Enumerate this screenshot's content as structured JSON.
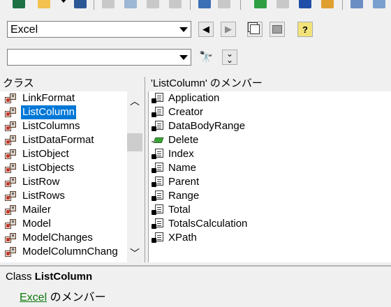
{
  "toolbar": {
    "icons": [
      "excel-icon",
      "userform-icon",
      "dropdown-icon",
      "save-icon",
      "cut-icon",
      "copy-icon",
      "paste-icon",
      "find-icon",
      "undo-icon",
      "redo-icon",
      "run-icon",
      "break-icon",
      "reset-icon",
      "design-mode-icon",
      "project-explorer-icon",
      "properties-icon"
    ]
  },
  "library": {
    "selected": "Excel",
    "buttons": [
      "previous",
      "next",
      "copy-to-clipboard",
      "view-definition",
      "help"
    ]
  },
  "search": {
    "value": "",
    "buttons": [
      "search",
      "show-hide-results"
    ]
  },
  "classes_pane": {
    "header": "クラス",
    "items": [
      {
        "label": "LinkFormat",
        "selected": false
      },
      {
        "label": "ListColumn",
        "selected": true
      },
      {
        "label": "ListColumns",
        "selected": false
      },
      {
        "label": "ListDataFormat",
        "selected": false
      },
      {
        "label": "ListObject",
        "selected": false
      },
      {
        "label": "ListObjects",
        "selected": false
      },
      {
        "label": "ListRow",
        "selected": false
      },
      {
        "label": "ListRows",
        "selected": false
      },
      {
        "label": "Mailer",
        "selected": false
      },
      {
        "label": "Model",
        "selected": false
      },
      {
        "label": "ModelChanges",
        "selected": false
      },
      {
        "label": "ModelColumnChang",
        "selected": false
      }
    ]
  },
  "members_pane": {
    "header": "'ListColumn' のメンバー",
    "items": [
      {
        "label": "Application",
        "kind": "property"
      },
      {
        "label": "Creator",
        "kind": "property"
      },
      {
        "label": "DataBodyRange",
        "kind": "property"
      },
      {
        "label": "Delete",
        "kind": "method"
      },
      {
        "label": "Index",
        "kind": "property"
      },
      {
        "label": "Name",
        "kind": "property"
      },
      {
        "label": "Parent",
        "kind": "property"
      },
      {
        "label": "Range",
        "kind": "property"
      },
      {
        "label": "Total",
        "kind": "property"
      },
      {
        "label": "TotalsCalculation",
        "kind": "property"
      },
      {
        "label": "XPath",
        "kind": "property"
      }
    ]
  },
  "detail": {
    "prefix": "Class",
    "name": "ListColumn",
    "library_link": "Excel",
    "member_of": "のメンバー"
  },
  "colors": {
    "selection": "#0078d7",
    "link": "#0b7a0b"
  }
}
